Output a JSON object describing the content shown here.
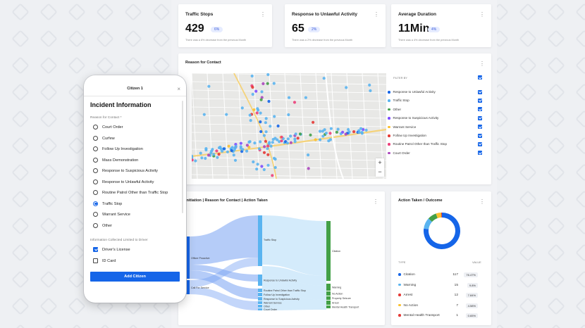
{
  "kpis": [
    {
      "title": "Traffic Stops",
      "value": "429",
      "change": "6%",
      "sub": "There was a 6% decrease from the previous Month"
    },
    {
      "title": "Response to Unlawful Activity",
      "value": "65",
      "change": "2%",
      "sub": "There was a 2% decrease from the previous Month"
    },
    {
      "title": "Average Duration",
      "value": "11Min",
      "change": "4%",
      "sub": "There was a 4% decrease from the previous Month"
    }
  ],
  "reason_card": {
    "title": "Reason for Contact",
    "filter_label": "FILTER BY",
    "filters": [
      {
        "label": "Response to Unlawful Activity",
        "color": "#1565e8"
      },
      {
        "label": "Traffic Stop",
        "color": "#5ab4f0"
      },
      {
        "label": "Other",
        "color": "#43a047"
      },
      {
        "label": "Response to Suspicious Activity",
        "color": "#7c4dff"
      },
      {
        "label": "Warrant Service",
        "color": "#fbc02d"
      },
      {
        "label": "Follow Up Investigation",
        "color": "#e53935"
      },
      {
        "label": "Routine Patrol Other than Traffic Stop",
        "color": "#ec407a"
      },
      {
        "label": "Court Order",
        "color": "#ab47bc"
      }
    ],
    "zoom_in": "+",
    "zoom_out": "−"
  },
  "sankey_card": {
    "title": "Initiation | Reason for Contact | Action Taken",
    "left_nodes": [
      "Officer Proactive",
      "Call For Service"
    ],
    "mid_nodes": [
      "Traffic Stop",
      "Response to Unlawful Activity",
      "Routine Patrol Other than Traffic Stop",
      "Follow Up Investigation",
      "Response to Suspicious Activity",
      "Warrant Service",
      "Other",
      "Court Order"
    ],
    "right_nodes": [
      "Citation",
      "Warning",
      "No Action",
      "Property Seizure",
      "Arrest",
      "Mental Health Transport"
    ]
  },
  "outcome_card": {
    "title": "Action Taken / Outcome",
    "col_type": "TYPE",
    "col_value": "VALUE",
    "rows": [
      {
        "label": "Citation",
        "value": "117",
        "pct": "76.47%",
        "color": "#1565e8"
      },
      {
        "label": "Warning",
        "value": "15",
        "pct": "9.8%",
        "color": "#5ab4f0"
      },
      {
        "label": "Arrest",
        "value": "12",
        "pct": "7.84%",
        "color": "#e53935"
      },
      {
        "label": "No Action",
        "value": "7",
        "pct": "4.58%",
        "color": "#fbc02d"
      },
      {
        "label": "Mental Health Transport",
        "value": "1",
        "pct": "0.65%",
        "color": "#e53935"
      }
    ],
    "donut": [
      {
        "label": "Citation",
        "value": 117,
        "color": "#1565e8"
      },
      {
        "label": "Warning",
        "value": 15,
        "color": "#5ab4f0"
      },
      {
        "label": "Arrest",
        "value": 12,
        "color": "#43a047"
      },
      {
        "label": "No Action",
        "value": 7,
        "color": "#fbc02d"
      },
      {
        "label": "Mental Health Transport",
        "value": 1,
        "color": "#e53935"
      }
    ]
  },
  "phone": {
    "header": "Citizen 1",
    "close": "×",
    "title": "Incident Information",
    "reason_label": "Reason for Contact *",
    "options": [
      {
        "label": "Court Order",
        "selected": false
      },
      {
        "label": "Curfew",
        "selected": false
      },
      {
        "label": "Follow Up Investigation",
        "selected": false
      },
      {
        "label": "Mass Demonstration",
        "selected": false
      },
      {
        "label": "Response to Suspicious Activity",
        "selected": false
      },
      {
        "label": "Response to Unlawful Activity",
        "selected": false
      },
      {
        "label": "Routine Patrol Other than Traffic Stop",
        "selected": false
      },
      {
        "label": "Traffic Stop",
        "selected": true
      },
      {
        "label": "Warrant Service",
        "selected": false
      },
      {
        "label": "Other",
        "selected": false
      }
    ],
    "info_label": "Information Collected Limited to Driver",
    "checks": [
      {
        "label": "Driver's License",
        "checked": true
      },
      {
        "label": "ID Card",
        "checked": false
      }
    ],
    "add_button": "Add Citizen"
  },
  "menu_glyph": "⋮"
}
